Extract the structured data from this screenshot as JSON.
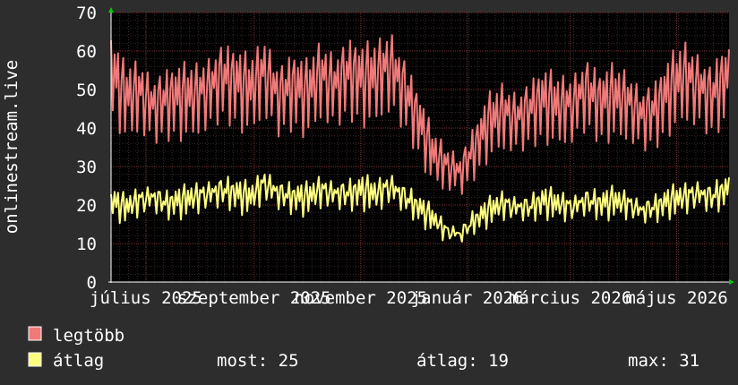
{
  "chart_data": {
    "type": "line",
    "ylabel": "onlinestream.live",
    "ylim": [
      0,
      70
    ],
    "yticks": [
      "0",
      "10",
      "20",
      "30",
      "40",
      "50",
      "60",
      "70"
    ],
    "xrange": [
      "2025-06-11",
      "2026-05-31"
    ],
    "xticks": [
      {
        "label": "július 2025",
        "date": "2025-07-01"
      },
      {
        "label": "szeptember 2025",
        "date": "2025-09-01"
      },
      {
        "label": "november 2025",
        "date": "2025-11-01"
      },
      {
        "label": "január 2026",
        "date": "2026-01-01"
      },
      {
        "label": "március 2026",
        "date": "2026-03-01"
      },
      {
        "label": "május 2026",
        "date": "2026-05-01"
      }
    ],
    "grid": true,
    "series": [
      {
        "name": "legtöbb",
        "color": "#f07a7a",
        "x": [
          "2025-06-11",
          "2025-06-19",
          "2025-06-27",
          "2025-07-05",
          "2025-07-13",
          "2025-07-21",
          "2025-07-29",
          "2025-08-06",
          "2025-08-14",
          "2025-08-22",
          "2025-08-30",
          "2025-09-07",
          "2025-09-15",
          "2025-09-23",
          "2025-10-01",
          "2025-10-09",
          "2025-10-17",
          "2025-10-25",
          "2025-11-02",
          "2025-11-10",
          "2025-11-18",
          "2025-11-26",
          "2025-12-04",
          "2025-12-12",
          "2025-12-20",
          "2025-12-28",
          "2026-01-05",
          "2026-01-13",
          "2026-01-21",
          "2026-01-29",
          "2026-02-06",
          "2026-02-14",
          "2026-02-22",
          "2026-03-02",
          "2026-03-10",
          "2026-03-18",
          "2026-03-26",
          "2026-04-03",
          "2026-04-11",
          "2026-04-19",
          "2026-04-27",
          "2026-05-05",
          "2026-05-13",
          "2026-05-21",
          "2026-05-29"
        ],
        "values": [
          64,
          56,
          57,
          53,
          55,
          56,
          56,
          58,
          62,
          60,
          58,
          63,
          56,
          59,
          57,
          62,
          59,
          63,
          61,
          62,
          65,
          58,
          49,
          39,
          35,
          33,
          40,
          48,
          51,
          49,
          52,
          55,
          53,
          53,
          58,
          54,
          56,
          54,
          50,
          52,
          58,
          62,
          59,
          56,
          61
        ]
      },
      {
        "name": "átlag",
        "color": "#ffff80",
        "x": [
          "2025-06-11",
          "2025-06-19",
          "2025-06-27",
          "2025-07-05",
          "2025-07-13",
          "2025-07-21",
          "2025-07-29",
          "2025-08-06",
          "2025-08-14",
          "2025-08-22",
          "2025-08-30",
          "2025-09-07",
          "2025-09-15",
          "2025-09-23",
          "2025-10-01",
          "2025-10-09",
          "2025-10-17",
          "2025-10-25",
          "2025-11-02",
          "2025-11-10",
          "2025-11-18",
          "2025-11-26",
          "2025-12-04",
          "2025-12-12",
          "2025-12-20",
          "2025-12-28",
          "2026-01-05",
          "2026-01-13",
          "2026-01-21",
          "2026-01-29",
          "2026-02-06",
          "2026-02-14",
          "2026-02-22",
          "2026-03-02",
          "2026-03-10",
          "2026-03-18",
          "2026-03-26",
          "2026-04-03",
          "2026-04-11",
          "2026-04-19",
          "2026-04-27",
          "2026-05-05",
          "2026-05-13",
          "2026-05-21",
          "2026-05-29"
        ],
        "values": [
          24,
          22,
          24,
          25,
          23,
          24,
          25,
          26,
          27,
          26,
          25,
          29,
          26,
          25,
          25,
          27,
          26,
          26,
          27,
          26,
          28,
          25,
          22,
          19,
          15,
          14,
          18,
          21,
          23,
          22,
          22,
          24,
          23,
          22,
          24,
          23,
          24,
          23,
          21,
          22,
          24,
          25,
          26,
          25,
          27
        ]
      }
    ]
  },
  "legend": {
    "items": [
      {
        "label": "legtöbb",
        "color": "#f07a7a"
      },
      {
        "label": "átlag",
        "color": "#ffff80"
      }
    ],
    "stats": {
      "now_label": "most:",
      "now_value": "25",
      "avg_label": "átlag:",
      "avg_value": "19",
      "max_label": "max:",
      "max_value": "31"
    }
  }
}
